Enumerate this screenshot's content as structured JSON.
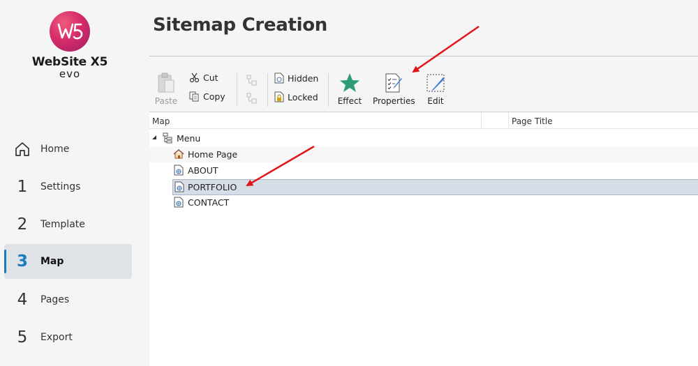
{
  "app": {
    "name": "WebSite X5",
    "edition": "evo"
  },
  "nav": {
    "home": "Home",
    "items": [
      {
        "num": "1",
        "label": "Settings"
      },
      {
        "num": "2",
        "label": "Template"
      },
      {
        "num": "3",
        "label": "Map"
      },
      {
        "num": "4",
        "label": "Pages"
      },
      {
        "num": "5",
        "label": "Export"
      }
    ]
  },
  "page": {
    "title": "Sitemap Creation"
  },
  "toolbar": {
    "paste": "Paste",
    "cut": "Cut",
    "copy": "Copy",
    "hidden": "Hidden",
    "locked": "Locked",
    "effect": "Effect",
    "properties": "Properties",
    "edit": "Edit"
  },
  "tree": {
    "columns": [
      "Map",
      "Page Title"
    ],
    "root": "Menu",
    "pages": [
      "Home Page",
      "ABOUT",
      "PORTFOLIO",
      "CONTACT"
    ],
    "selected": "PORTFOLIO"
  },
  "colors": {
    "accent": "#1b7bbf",
    "selected_row": "#d6dde7",
    "annotation_arrow": "#e0161b"
  }
}
